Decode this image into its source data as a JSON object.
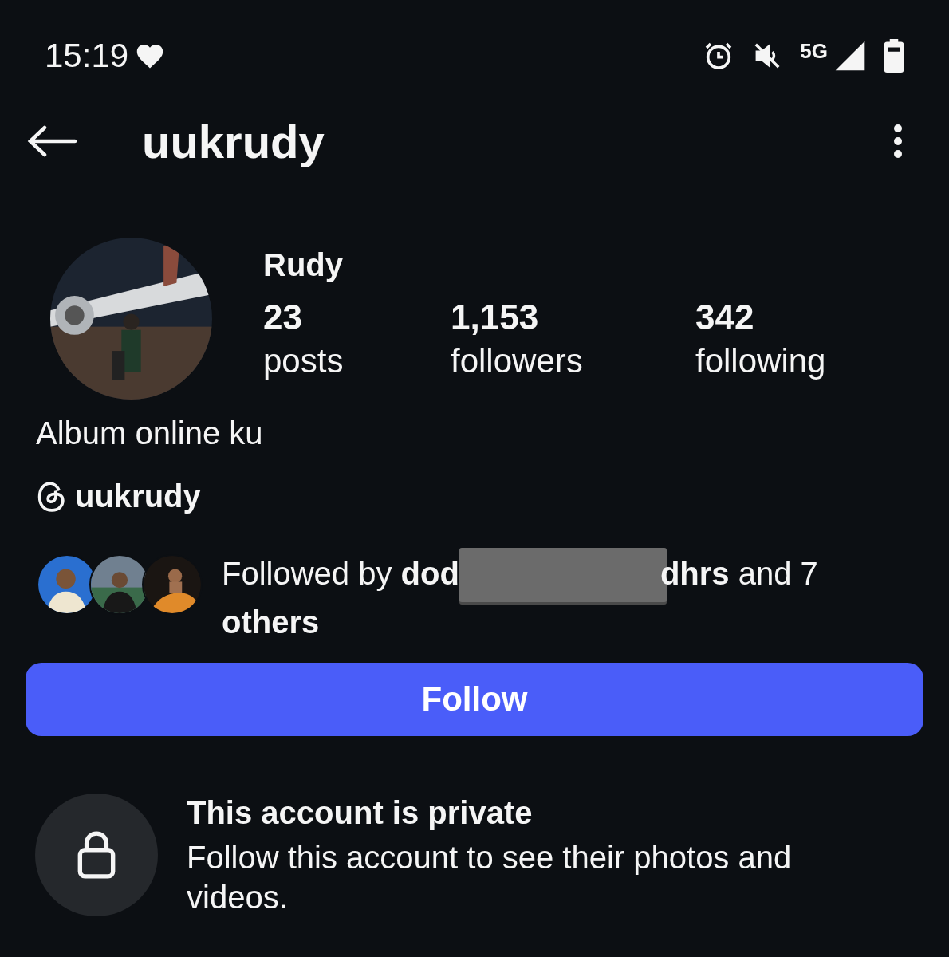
{
  "status_bar": {
    "time": "15:19",
    "network": "5G"
  },
  "header": {
    "username": "uukrudy"
  },
  "profile": {
    "name": "Rudy",
    "stats": [
      {
        "value": "23",
        "label": "posts"
      },
      {
        "value": "1,153",
        "label": "followers"
      },
      {
        "value": "342",
        "label": "following"
      }
    ],
    "bio": "Album online ku",
    "threads_handle": "uukrudy"
  },
  "followed_by": {
    "text_before": "Followed by **dod**",
    "text_after": "**dhrs** and 7",
    "text_second_line": "**others**",
    "redacted": true
  },
  "follow_button": {
    "label": "Follow"
  },
  "private_notice": {
    "title": "This account is private",
    "message": "Follow this account to see their photos and videos."
  }
}
